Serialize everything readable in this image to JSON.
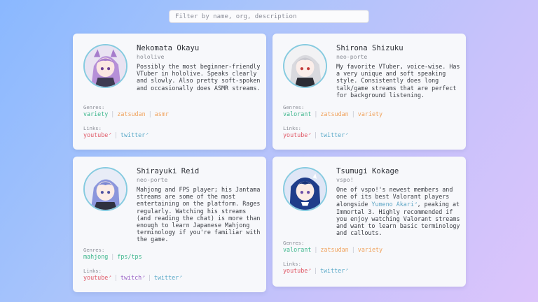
{
  "search": {
    "placeholder": "Filter by name, org, description"
  },
  "labels": {
    "genres": "Genres:",
    "links": "Links:"
  },
  "colors": {
    "genre_variety": "#3cb68c",
    "genre_zatsudan": "#f0a25c",
    "genre_asmr": "#f0a25c",
    "genre_valorant": "#3cb68c",
    "genre_mahjong": "#3cb68c",
    "genre_fps": "#3cb68c",
    "link_youtube": "#e05a68",
    "link_twitter": "#5aa9c8",
    "link_twitch": "#9a63c6"
  },
  "cards": [
    {
      "name": "Nekomata Okayu",
      "org": "hololive",
      "description": "Possibly the most beginner-friendly VTuber in hololive. Speaks clearly and slowly. Also pretty soft-spoken and occasionally does ASMR streams.",
      "genres": [
        {
          "label": "variety",
          "color": "#3cb68c"
        },
        {
          "label": "zatsudan",
          "color": "#f0a25c"
        },
        {
          "label": "asmr",
          "color": "#f0a25c"
        }
      ],
      "links": [
        {
          "label": "youtube",
          "color": "#e05a68"
        },
        {
          "label": "twitter",
          "color": "#5aa9c8"
        }
      ]
    },
    {
      "name": "Shirona Shizuku",
      "org": "neo-porte",
      "description": "My favorite VTuber, voice-wise. Has a very unique and soft speaking style. Consistently does long talk/game streams that are perfect for background listening.",
      "genres": [
        {
          "label": "valorant",
          "color": "#3cb68c"
        },
        {
          "label": "zatsudan",
          "color": "#f0a25c"
        },
        {
          "label": "variety",
          "color": "#f0a25c"
        }
      ],
      "links": [
        {
          "label": "youtube",
          "color": "#e05a68"
        },
        {
          "label": "twitter",
          "color": "#5aa9c8"
        }
      ]
    },
    {
      "name": "Shirayuki Reid",
      "org": "neo-porte",
      "description": "Mahjong and FPS player; his Jantama streams are some of the most entertaining on the platform. Rages regularly. Watching his streams (and reading the chat) is more than enough to learn Japanese Mahjong terminology if you're familiar with the game.",
      "genres": [
        {
          "label": "mahjong",
          "color": "#3cb68c"
        },
        {
          "label": "fps/tps",
          "color": "#3cb68c"
        }
      ],
      "links": [
        {
          "label": "youtube",
          "color": "#e05a68"
        },
        {
          "label": "twitch",
          "color": "#9a63c6"
        },
        {
          "label": "twitter",
          "color": "#5aa9c8"
        }
      ]
    },
    {
      "name": "Tsumugi Kokage",
      "org": "vspo!",
      "description_parts": [
        {
          "text": "One of vspo!'s newest members and one of its best Valorant players alongside "
        },
        {
          "text": "Yumeno Akari",
          "link": true
        },
        {
          "text": ", peaking at Immortal 3. Highly recommended if you enjoy watching Valorant streams and want to learn basic terminology and callouts."
        }
      ],
      "genres": [
        {
          "label": "valorant",
          "color": "#3cb68c"
        },
        {
          "label": "zatsudan",
          "color": "#f0a25c"
        },
        {
          "label": "variety",
          "color": "#f0a25c"
        }
      ],
      "links": [
        {
          "label": "youtube",
          "color": "#e05a68"
        },
        {
          "label": "twitter",
          "color": "#5aa9c8"
        }
      ]
    }
  ]
}
